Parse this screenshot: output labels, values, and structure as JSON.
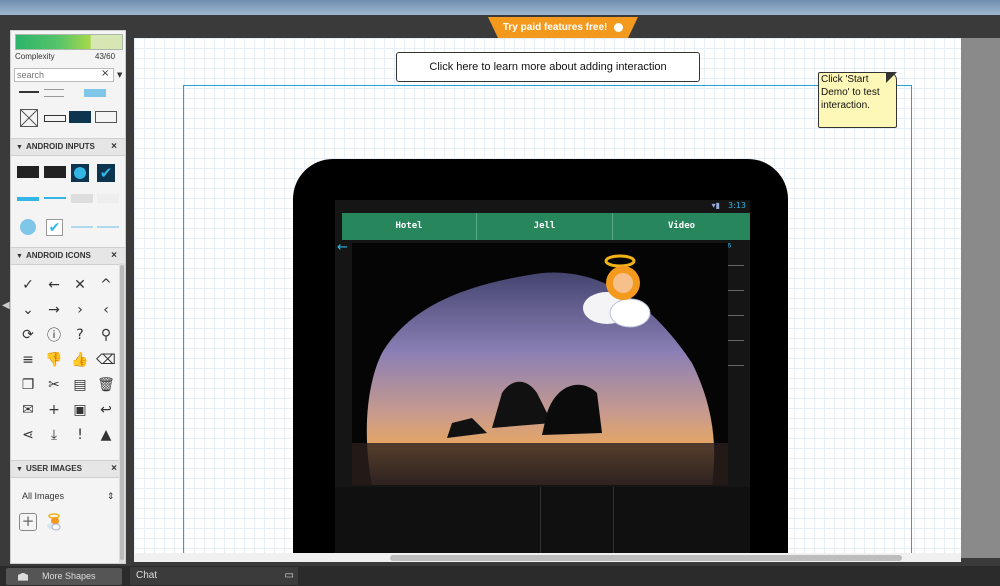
{
  "promo": {
    "label": "Try paid features free!"
  },
  "sidebar": {
    "complexity_label": "Complexity",
    "complexity_value": "43/60",
    "complexity_fraction": 0.72,
    "search_placeholder": "search",
    "search_clear": "×",
    "sections": [
      {
        "title": "ANDROID INPUTS",
        "close": "×"
      },
      {
        "title": "ANDROID ICONS",
        "close": "×"
      },
      {
        "title": "USER IMAGES",
        "close": "×"
      }
    ],
    "android_icons": [
      "✓",
      "←",
      "✕",
      "^",
      "⌄",
      "→",
      "›",
      "‹",
      "⟳",
      "ⓘ",
      "?",
      "⚲",
      "≡",
      "👎",
      "👍",
      "⌫",
      "❐",
      "✂",
      "▤",
      "🗑",
      "✉",
      "+",
      "▣",
      "↩",
      "⋖",
      "⤓",
      "!",
      "▲"
    ],
    "user_images": {
      "dropdown_value": "All Images",
      "dropdown_arrow": "⇕",
      "add_label": "+"
    }
  },
  "canvas": {
    "instruction_text": "Click here to learn more about adding interaction",
    "sticky_note": "Click 'Start Demo' to test interaction."
  },
  "tablet": {
    "status_time": "3:13",
    "tabs": [
      "Hotel",
      "Jell",
      "Video"
    ]
  },
  "footer": {
    "more_shapes": "More Shapes",
    "chat": "Chat",
    "chat_icon": "▭"
  },
  "colors": {
    "accent_orange": "#f39a1e",
    "frame_blue": "#27a3d3",
    "tab_green": "#27865c",
    "sticky_yellow": "#fdf8b7"
  }
}
